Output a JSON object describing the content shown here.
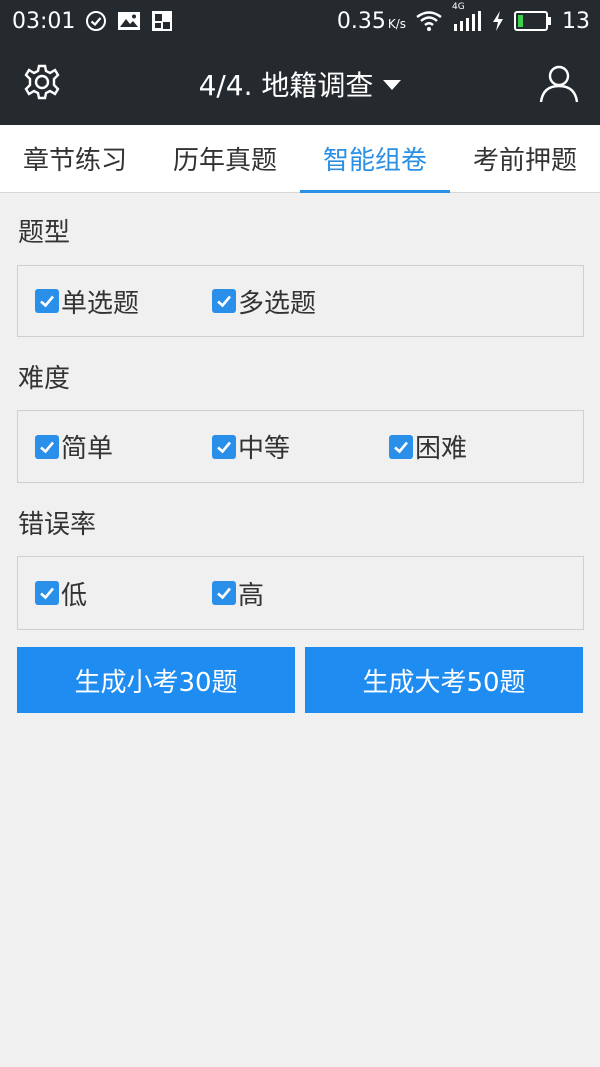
{
  "status_bar": {
    "time": "03:01",
    "speed": "0.35",
    "speed_unit": "K/s",
    "network": "4G",
    "battery": "13",
    "icons": [
      "check-circle-icon",
      "image-icon",
      "app-notification-icon",
      "wifi-icon",
      "signal-icon",
      "charging-icon",
      "battery-icon"
    ]
  },
  "header": {
    "title": "4/4. 地籍调查",
    "left_icon": "gear-icon",
    "right_icon": "user-icon"
  },
  "tabs": [
    {
      "label": "章节练习",
      "active": false
    },
    {
      "label": "历年真题",
      "active": false
    },
    {
      "label": "智能组卷",
      "active": true
    },
    {
      "label": "考前押题",
      "active": false
    }
  ],
  "sections": {
    "type": {
      "label": "题型",
      "options": [
        {
          "label": "单选题",
          "checked": true
        },
        {
          "label": "多选题",
          "checked": true
        }
      ]
    },
    "difficulty": {
      "label": "难度",
      "options": [
        {
          "label": "简单",
          "checked": true
        },
        {
          "label": "中等",
          "checked": true
        },
        {
          "label": "困难",
          "checked": true
        }
      ]
    },
    "error_rate": {
      "label": "错误率",
      "options": [
        {
          "label": "低",
          "checked": true
        },
        {
          "label": "高",
          "checked": true
        }
      ]
    }
  },
  "buttons": {
    "small_exam": "生成小考30题",
    "big_exam": "生成大考50题"
  },
  "colors": {
    "header_bg": "#252a2e",
    "accent": "#2b8fe4",
    "button": "#1e8cf0",
    "background": "#f0f0f0"
  }
}
